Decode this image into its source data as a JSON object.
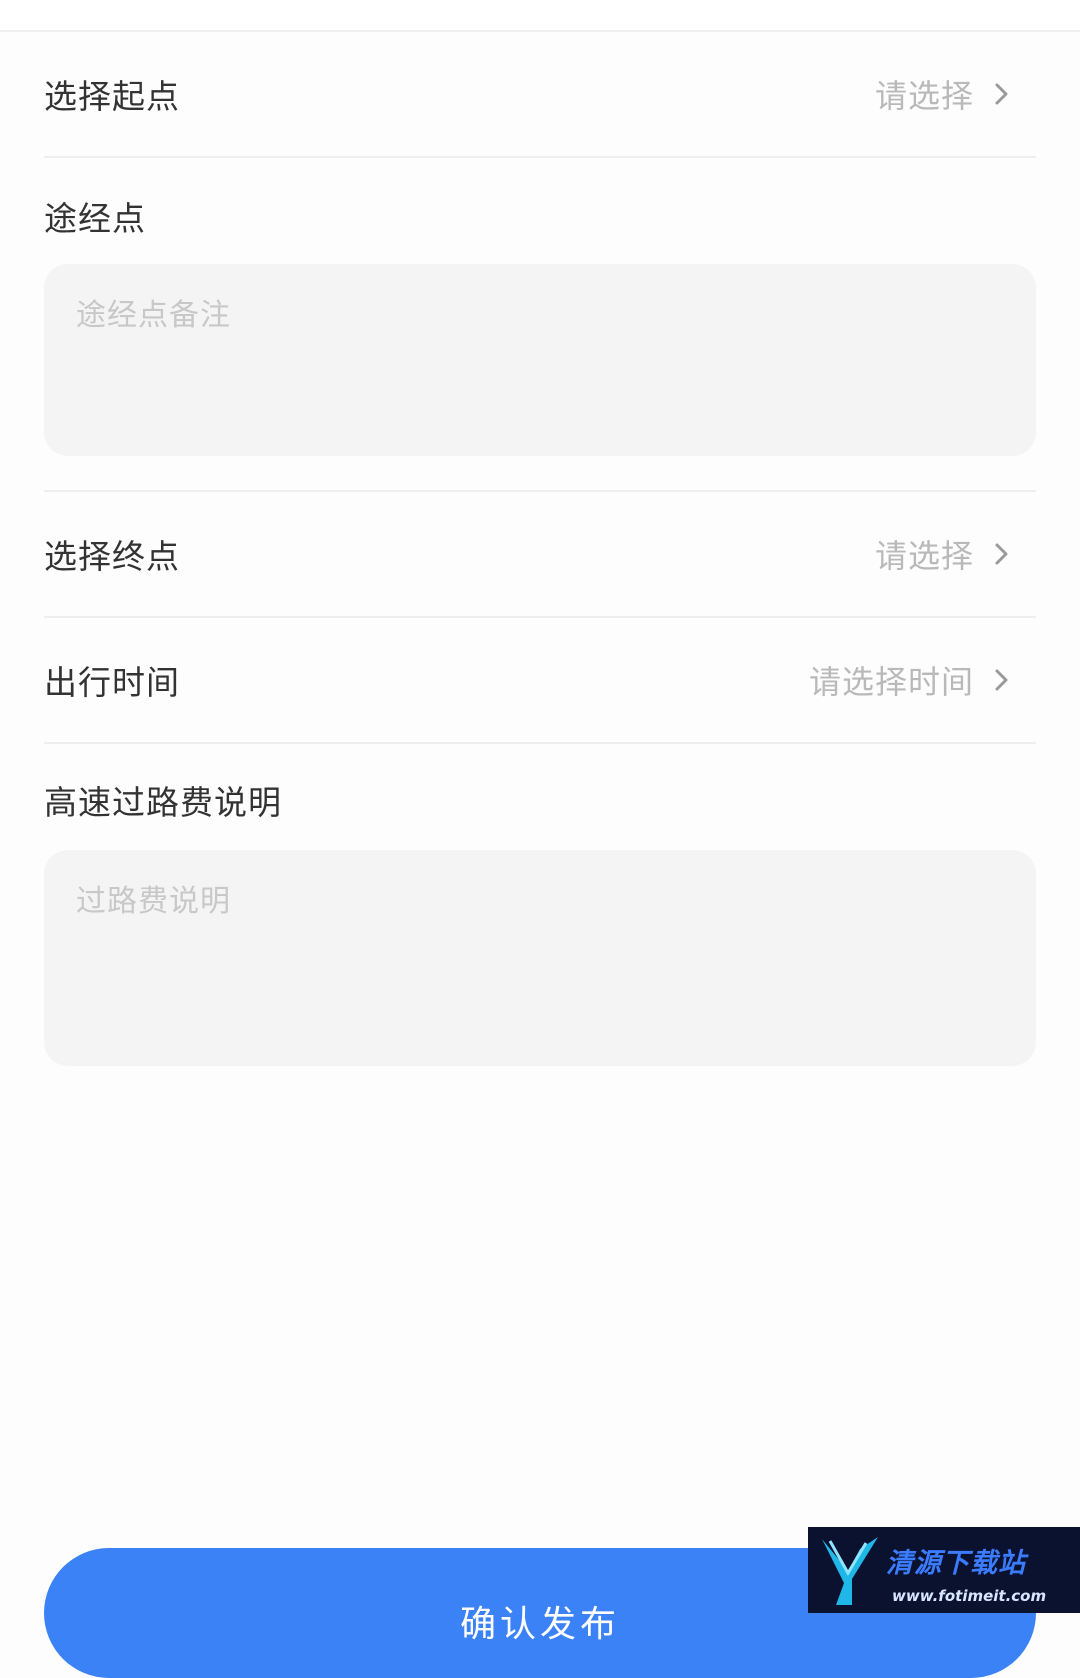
{
  "form": {
    "start": {
      "label": "选择起点",
      "value": "请选择"
    },
    "waypoint": {
      "label": "途经点",
      "placeholder": "途经点备注"
    },
    "end": {
      "label": "选择终点",
      "value": "请选择"
    },
    "time": {
      "label": "出行时间",
      "value": "请选择时间"
    },
    "toll": {
      "label": "高速过路费说明",
      "placeholder": "过路费说明"
    }
  },
  "submit": {
    "label": "确认发布"
  },
  "watermark": {
    "title": "清源下载站",
    "url": "www.fotimeit.com"
  },
  "colors": {
    "primary": "#3b82f6",
    "placeholder": "#b9b9b9",
    "field_bg": "#f4f4f4",
    "text": "#333333"
  },
  "icons": {
    "row_chevron": "chevron-right-icon",
    "watermark_logo": "site-logo-icon"
  }
}
